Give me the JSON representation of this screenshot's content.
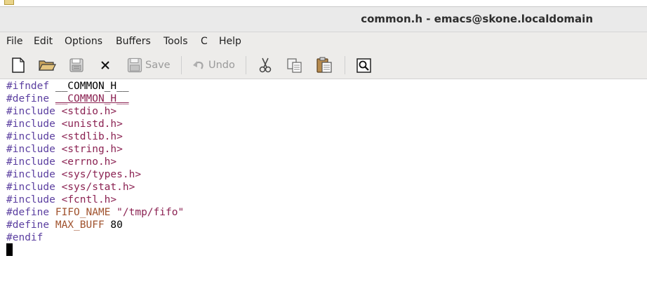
{
  "window": {
    "title": "common.h - emacs@skone.localdomain"
  },
  "menubar": {
    "items": [
      "File",
      "Edit",
      "Options",
      "Buffers",
      "Tools",
      "C",
      "Help"
    ]
  },
  "toolbar": {
    "save_label": "Save",
    "undo_label": "Undo",
    "icons": [
      "new-file-icon",
      "open-folder-icon",
      "save-disk-icon",
      "close-icon",
      "save-icon",
      "undo-icon",
      "cut-icon",
      "copy-icon",
      "paste-icon",
      "search-icon"
    ]
  },
  "editor": {
    "lines": [
      [
        "#ifndef",
        " ",
        "__COMMON_H__"
      ],
      [
        "#define",
        " ",
        "__COMMON_H__"
      ],
      [
        "#include",
        " ",
        "<stdio.h>"
      ],
      [
        "#include",
        " ",
        "<unistd.h>"
      ],
      [
        "#include",
        " ",
        "<stdlib.h>"
      ],
      [
        "#include",
        " ",
        "<string.h>"
      ],
      [
        "#include",
        " ",
        "<errno.h>"
      ],
      [
        "#include",
        " ",
        "<sys/types.h>"
      ],
      [
        "#include",
        " ",
        "<sys/stat.h>"
      ],
      [
        "#include",
        " ",
        "<fcntl.h>"
      ],
      [
        "#define",
        " ",
        "FIFO_NAME",
        " ",
        "\"/tmp/fifo\""
      ],
      [
        "#define",
        " ",
        "MAX_BUFF",
        " ",
        "80"
      ],
      [
        "#endif"
      ]
    ]
  },
  "colors": {
    "keyword": "#5b3fa0",
    "string": "#8b2252",
    "variable": "#a0522d",
    "text": "#000000"
  }
}
